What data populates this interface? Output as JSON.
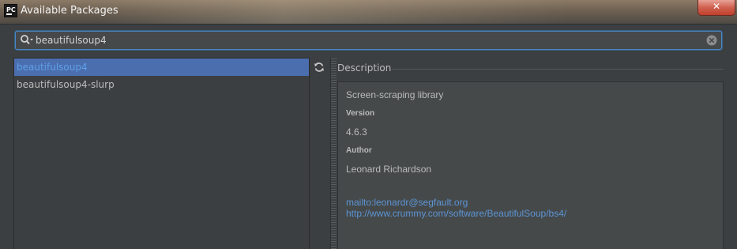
{
  "window": {
    "app_icon_text": "PC",
    "title": "Available Packages",
    "close_label": "✕"
  },
  "search": {
    "value": "beautifulsoup4"
  },
  "packages": [
    {
      "name": "beautifulsoup4",
      "selected": true
    },
    {
      "name": "beautifulsoup4-slurp",
      "selected": false
    }
  ],
  "description": {
    "header": "Description",
    "summary": "Screen-scraping library",
    "version_label": "Version",
    "version": "4.6.3",
    "author_label": "Author",
    "author": "Leonard Richardson",
    "email_link": "mailto:leonardr@segfault.org",
    "homepage_link": "http://www.crummy.com/software/BeautifulSoup/bs4/"
  },
  "colors": {
    "background": "#3c3f41",
    "selection": "#4b6eaf",
    "link": "#5d94d4",
    "focus_border": "#4a88c7",
    "close_button": "#c75450"
  },
  "icons": [
    "search-icon",
    "clear-search-icon",
    "refresh-icon",
    "close-icon"
  ]
}
